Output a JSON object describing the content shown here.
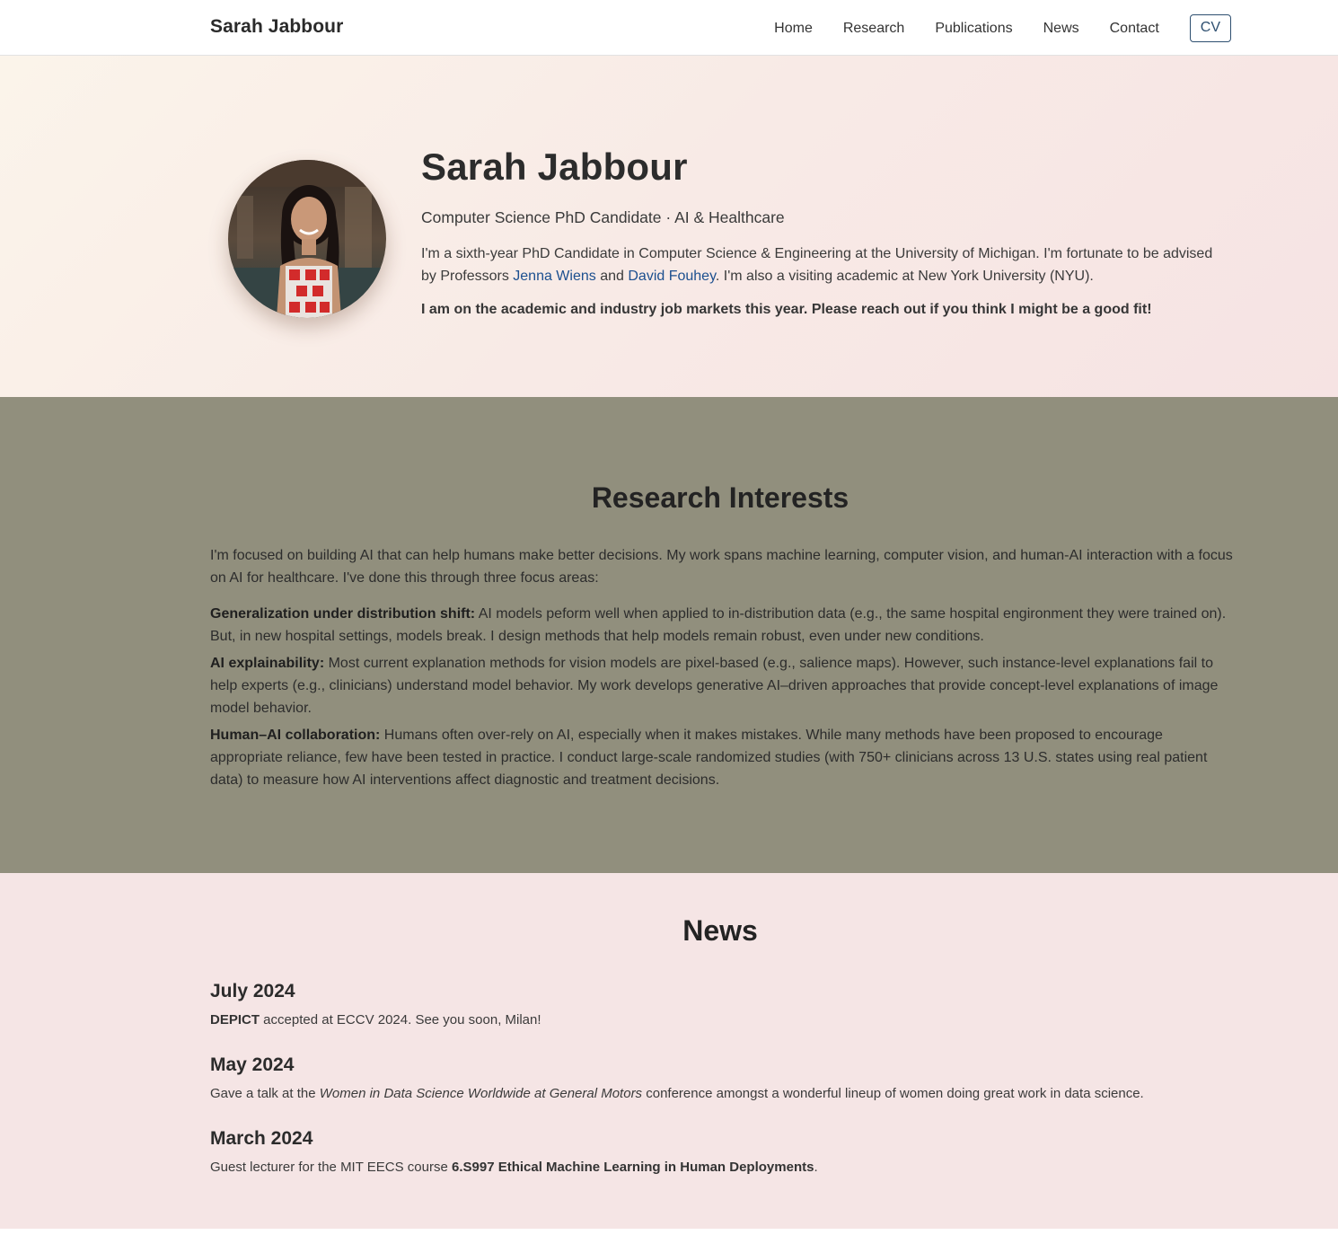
{
  "header": {
    "brand": "Sarah Jabbour",
    "nav": [
      "Home",
      "Research",
      "Publications",
      "News",
      "Contact"
    ],
    "cv_label": "CV"
  },
  "hero": {
    "name": "Sarah Jabbour",
    "subtitle": "Computer Science PhD Candidate · AI & Healthcare",
    "bio_part1": "I'm a sixth-year PhD Candidate in Computer Science & Engineering at the University of Michigan. I'm fortunate to be advised by Professors ",
    "advisor1": "Jenna Wiens",
    "bio_and": " and ",
    "advisor2": "David Fouhey",
    "bio_part2": ". I'm also a visiting academic at New York University (NYU).",
    "job_market": "I am on the academic and industry job markets this year. Please reach out if you think I might be a good fit!"
  },
  "research": {
    "title": "Research Interests",
    "intro": "I'm focused on building AI that can help humans make better decisions. My work spans machine learning, computer vision, and human-AI interaction with a focus on AI for healthcare. I've done this through three focus areas:",
    "areas": [
      {
        "label": "Generalization under distribution shift:",
        "text": " AI models peform well when applied to in-distribution data (e.g., the same hospital engironment they were trained on). But, in new hospital settings, models break. I design methods that help models remain robust, even under new conditions."
      },
      {
        "label": "AI explainability:",
        "text": " Most current explanation methods for vision models are pixel-based (e.g., salience maps). However, such instance-level explanations fail to help experts (e.g., clinicians) understand model behavior. My work develops generative AI–driven approaches that provide concept-level explanations of image model behavior."
      },
      {
        "label": "Human–AI collaboration:",
        "text": " Humans often over-rely on AI, especially when it makes mistakes. While many methods have been proposed to encourage appropriate reliance, few have been tested in practice. I conduct large-scale randomized studies (with 750+ clinicians across 13 U.S. states using real patient data) to measure how AI interventions affect diagnostic and treatment decisions."
      }
    ]
  },
  "news": {
    "title": "News",
    "items": [
      {
        "date": "July 2024",
        "bold": "DEPICT",
        "text": " accepted at ECCV 2024. See you soon, Milan!"
      },
      {
        "date": "May 2024",
        "pre": "Gave a talk at the ",
        "italic": "Women in Data Science Worldwide at General Motors",
        "post": " conference amongst a wonderful lineup of women doing great work in data science."
      },
      {
        "date": "March 2024",
        "pre": "Guest lecturer for the MIT EECS course ",
        "bold": "6.S997 Ethical Machine Learning in Human Deployments",
        "post": "."
      }
    ]
  }
}
